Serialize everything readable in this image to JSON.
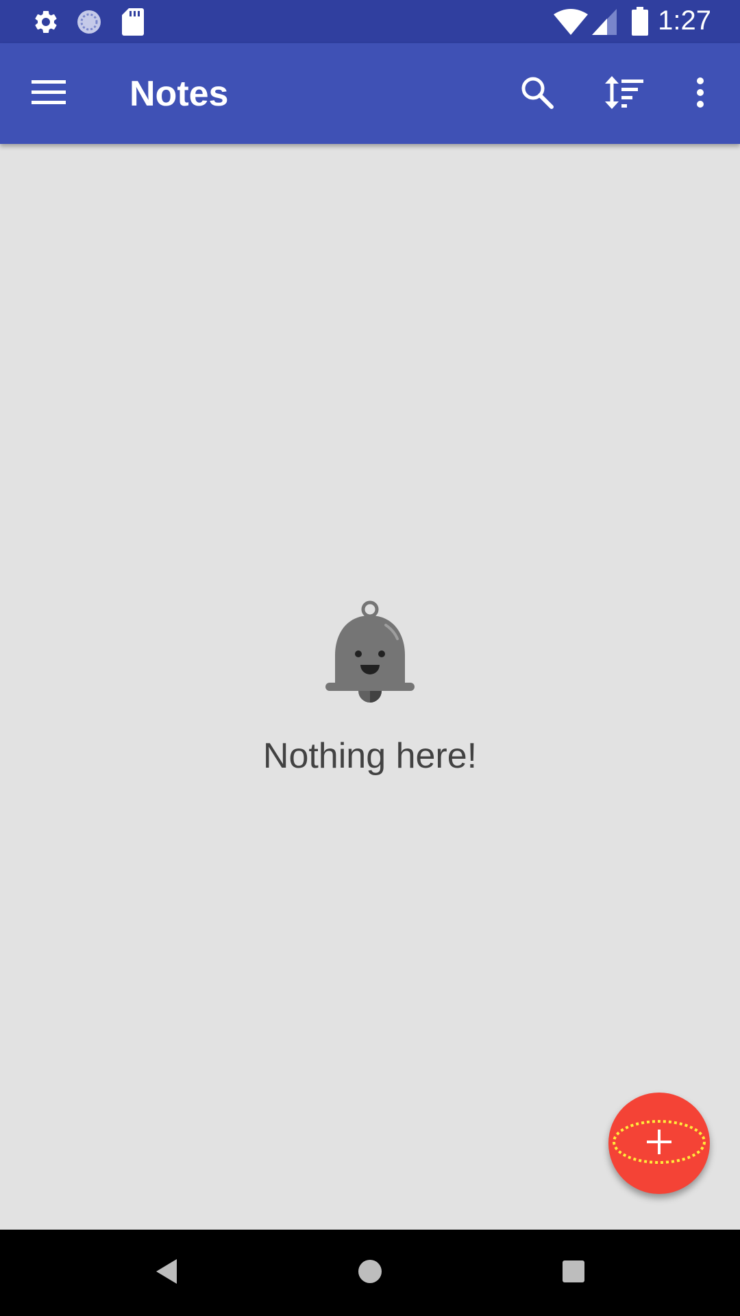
{
  "status_bar": {
    "time": "1:27",
    "icons": [
      "gear-icon",
      "sync-icon",
      "sd-card-icon",
      "wifi-icon",
      "signal-icon",
      "battery-icon"
    ]
  },
  "app_bar": {
    "title": "Notes",
    "icons": [
      "menu-icon",
      "search-icon",
      "sort-icon",
      "more-vert-icon"
    ],
    "color": "#3f51b5"
  },
  "empty_state": {
    "icon": "bell-icon",
    "message": "Nothing here!"
  },
  "fab": {
    "icon": "plus-icon",
    "color": "#f44336"
  },
  "nav_bar": {
    "icons": [
      "back-icon",
      "home-icon",
      "recents-icon"
    ]
  }
}
